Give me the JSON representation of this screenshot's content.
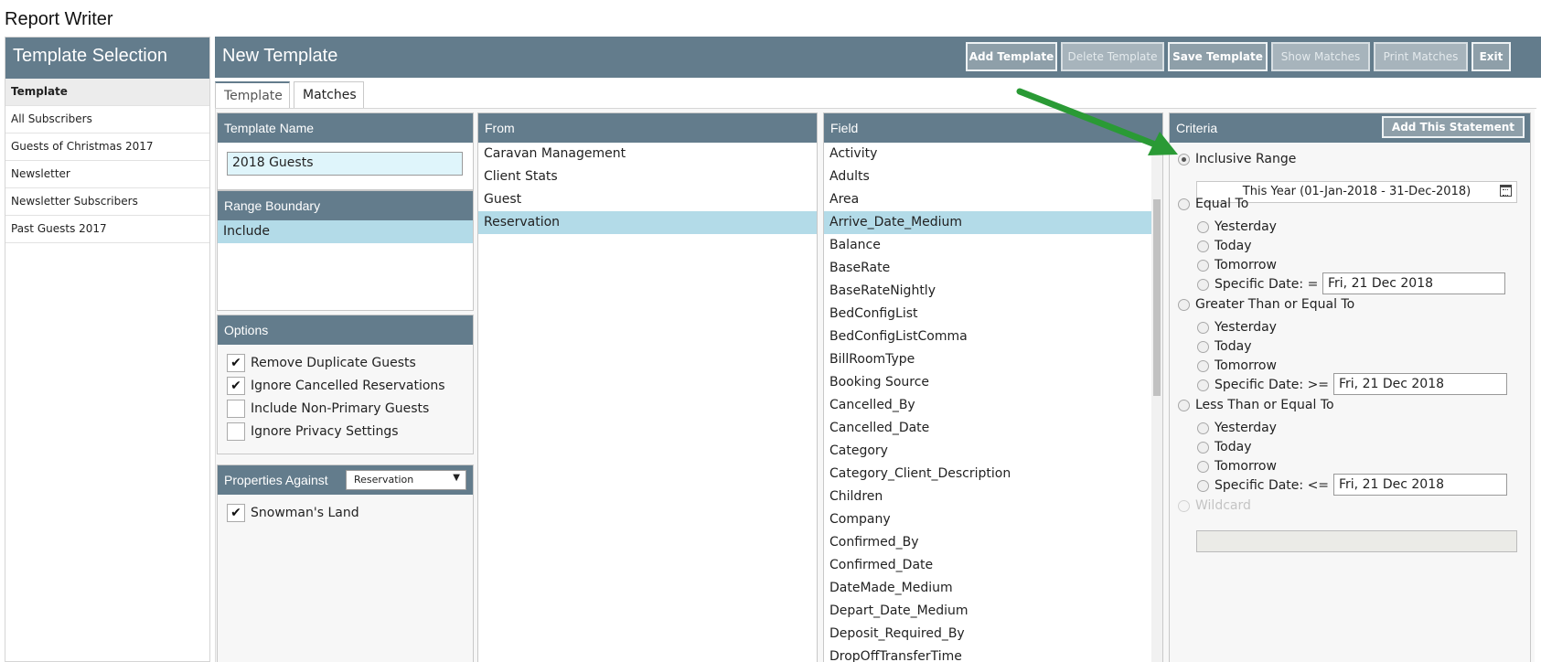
{
  "app": {
    "title": "Report Writer"
  },
  "selection": {
    "title": "Template Selection",
    "items": [
      "Template",
      "All Subscribers",
      "Guests of Christmas 2017",
      "Newsletter",
      "Newsletter Subscribers",
      "Past Guests 2017"
    ]
  },
  "header": {
    "title": "New Template",
    "buttons": {
      "add": "Add Template",
      "delete": "Delete Template",
      "save": "Save Template",
      "show": "Show Matches",
      "print": "Print Matches",
      "exit": "Exit"
    }
  },
  "tabs": [
    "Template",
    "Matches"
  ],
  "template_name": {
    "label": "Template Name",
    "value": "2018 Guests"
  },
  "range_boundary": {
    "label": "Range Boundary",
    "selected": "Include"
  },
  "options": {
    "label": "Options",
    "items": [
      {
        "label": "Remove Duplicate Guests",
        "checked": true
      },
      {
        "label": "Ignore Cancelled Reservations",
        "checked": true
      },
      {
        "label": "Include Non-Primary Guests",
        "checked": false
      },
      {
        "label": "Ignore Privacy Settings",
        "checked": false
      }
    ],
    "check_glyph": "✔"
  },
  "properties": {
    "label": "Properties Against",
    "select_value": "Reservation",
    "arrow": "▼",
    "items": [
      {
        "label": "Snowman's Land",
        "checked": true
      }
    ]
  },
  "from": {
    "label": "From",
    "items": [
      "Caravan Management",
      "Client Stats",
      "Guest",
      "Reservation"
    ],
    "selected": "Reservation"
  },
  "field": {
    "label": "Field",
    "items": [
      "Activity",
      "Adults",
      "Area",
      "Arrive_Date_Medium",
      "Balance",
      "BaseRate",
      "BaseRateNightly",
      "BedConfigList",
      "BedConfigListComma",
      "BillRoomType",
      "Booking Source",
      "Cancelled_By",
      "Cancelled_Date",
      "Category",
      "Category_Client_Description",
      "Children",
      "Company",
      "Confirmed_By",
      "Confirmed_Date",
      "DateMade_Medium",
      "Depart_Date_Medium",
      "Deposit_Required_By",
      "DropOffTransferTime"
    ],
    "selected": "Arrive_Date_Medium"
  },
  "criteria": {
    "label": "Criteria",
    "add_statement": "Add This Statement",
    "inclusive_range": {
      "label": "Inclusive Range",
      "value": "This Year (01-Jan-2018 - 31-Dec-2018)"
    },
    "equal_to": {
      "label": "Equal To",
      "specific_label": "Specific Date: =",
      "date": "Fri, 21 Dec 2018"
    },
    "gte": {
      "label": "Greater Than or Equal To",
      "specific_label": "Specific Date: >=",
      "date": "Fri, 21 Dec 2018"
    },
    "lte": {
      "label": "Less Than or Equal To",
      "specific_label": "Specific Date: <=",
      "date": "Fri, 21 Dec 2018"
    },
    "sub_options": [
      "Yesterday",
      "Today",
      "Tomorrow"
    ],
    "wildcard": {
      "label": "Wildcard"
    }
  },
  "annotation": {
    "arrow_color": "#2a9a35"
  }
}
